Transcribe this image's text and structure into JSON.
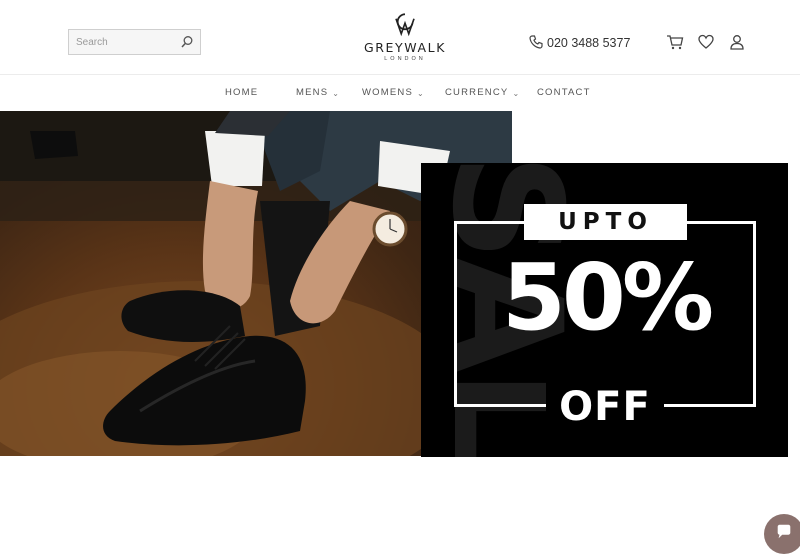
{
  "header": {
    "search": {
      "placeholder": "Search",
      "value": ""
    },
    "logo": {
      "brand": "GREYWALK",
      "sub": "LONDON"
    },
    "phone": "020 3488 5377",
    "icons": [
      "cart-icon",
      "heart-icon",
      "user-icon"
    ]
  },
  "nav": {
    "items": [
      {
        "label": "HOME",
        "has_dropdown": false
      },
      {
        "label": "MENS",
        "has_dropdown": true
      },
      {
        "label": "WOMENS",
        "has_dropdown": true
      },
      {
        "label": "CURRENCY",
        "has_dropdown": true
      },
      {
        "label": "CONTACT",
        "has_dropdown": false
      }
    ]
  },
  "hero": {
    "sale": {
      "watermark": "SALE",
      "upto": "UPTO",
      "percent": "50%",
      "off": "OFF"
    }
  },
  "chat": {
    "icon": "chat-icon"
  },
  "colors": {
    "sale_bg": "#000000",
    "chat_bg": "#8a716d"
  }
}
